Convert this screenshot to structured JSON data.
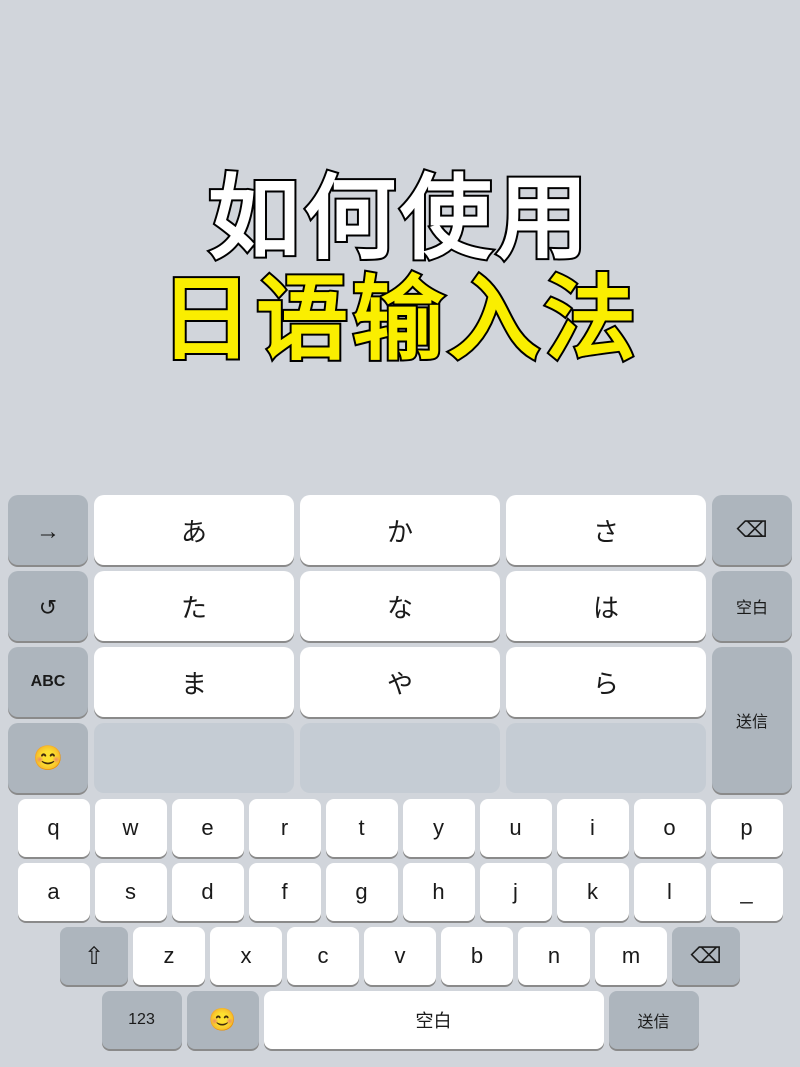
{
  "overlay": {
    "line1": "如何使用",
    "line2": "日语输入法"
  },
  "kana_keyboard": {
    "rows": [
      [
        "→",
        "あ",
        "か",
        "さ",
        "⌫"
      ],
      [
        "↺",
        "た",
        "な",
        "は",
        "空白"
      ],
      [
        "ABC",
        "ま",
        "や",
        "ら",
        "送信"
      ],
      [
        "😊",
        "",
        "",
        "",
        ""
      ]
    ],
    "row4_visible": [
      "😊"
    ]
  },
  "qwerty_row1": [
    "q",
    "w",
    "e",
    "r",
    "t",
    "y",
    "u",
    "i",
    "o",
    "p"
  ],
  "qwerty_row2": [
    "a",
    "s",
    "d",
    "f",
    "g",
    "h",
    "j",
    "k",
    "l",
    "_"
  ],
  "qwerty_row3_mid": [
    "z",
    "x",
    "c",
    "v",
    "b",
    "n",
    "m"
  ],
  "bottom_row": {
    "numbers": "123",
    "emoji": "😊",
    "space": "空白",
    "send": "送信"
  }
}
